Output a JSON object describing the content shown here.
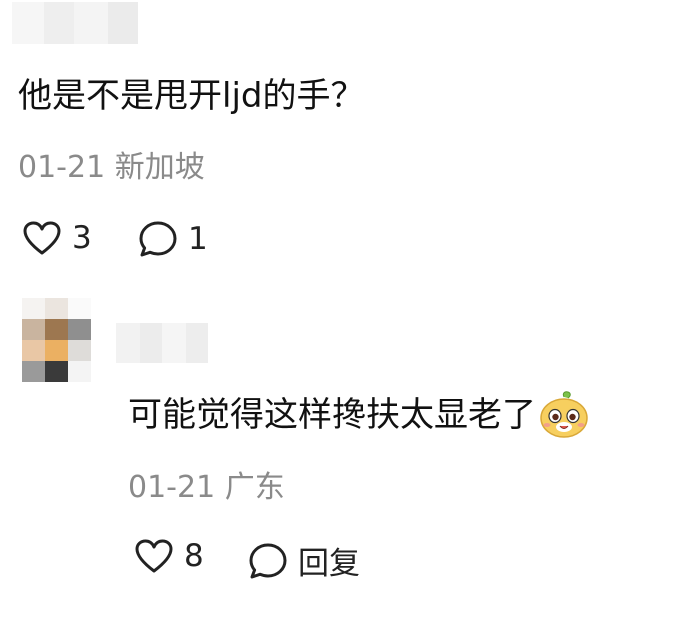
{
  "comments": [
    {
      "text": "他是不是甩开ljd的手？",
      "date": "01-21",
      "location": "新加坡",
      "likes": "3",
      "replies": "1"
    },
    {
      "text": "可能觉得这样搀扶太显老了",
      "date": "01-21",
      "location": "广东",
      "likes": "8",
      "reply_label": "回复",
      "emoji_icon": "smiling-fruit-sticker-icon"
    }
  ],
  "colors": {
    "text": "#111111",
    "meta": "#8a8a8a",
    "icon": "#222222"
  }
}
